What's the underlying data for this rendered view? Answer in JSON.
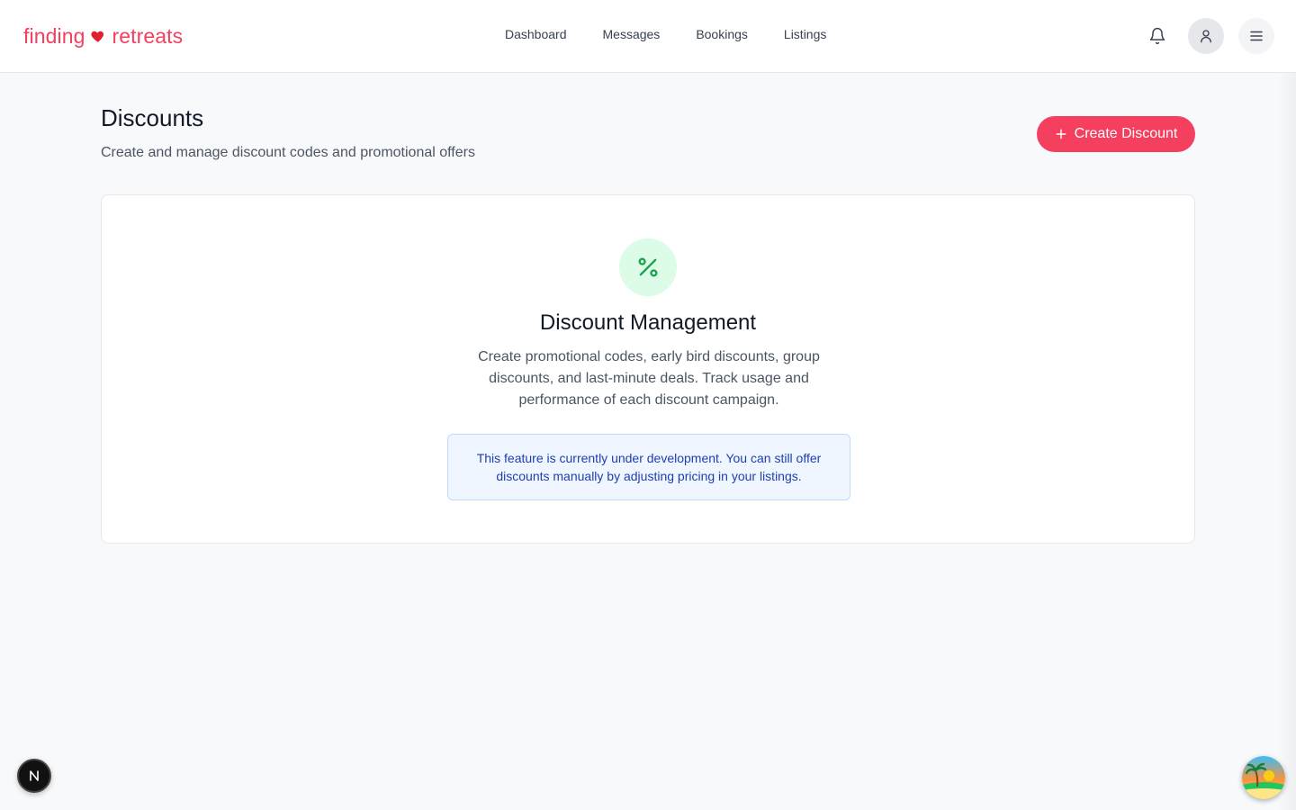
{
  "brand": {
    "word1": "finding",
    "word2": "retreats",
    "color": "#f43f5e"
  },
  "nav": {
    "items": [
      {
        "label": "Dashboard"
      },
      {
        "label": "Messages"
      },
      {
        "label": "Bookings"
      },
      {
        "label": "Listings"
      }
    ]
  },
  "header_icons": [
    "bell-icon",
    "user-icon",
    "menu-icon"
  ],
  "page": {
    "title": "Discounts",
    "subtitle": "Create and manage discount codes and promotional offers",
    "create_button": "Create Discount"
  },
  "card": {
    "icon": "percent-icon",
    "title": "Discount Management",
    "description": "Create promotional codes, early bird discounts, group discounts, and last-minute deals. Track usage and performance of each discount campaign.",
    "notice": "This feature is currently under development. You can still offer discounts manually by adjusting pricing in your listings."
  },
  "badges": {
    "next": "N"
  },
  "colors": {
    "accent": "#f43f5e",
    "success_bg": "#dcfce7",
    "success_icon": "#16a34a",
    "info_bg": "#eff6ff",
    "info_text": "#1e40af"
  }
}
